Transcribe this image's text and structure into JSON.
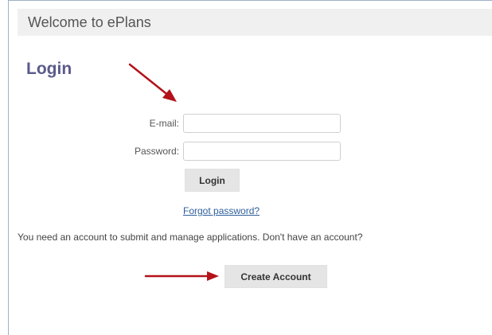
{
  "header": {
    "title": "Welcome to ePlans"
  },
  "login": {
    "heading": "Login",
    "email_label": "E-mail:",
    "email_value": "",
    "password_label": "Password:",
    "password_value": "",
    "login_button": "Login",
    "forgot_link": "Forgot password?"
  },
  "account": {
    "prompt": "You need an account to submit and manage applications. Don't have an account?",
    "create_button": "Create Account"
  },
  "annotations": {
    "arrow_color": "#b3121a"
  }
}
